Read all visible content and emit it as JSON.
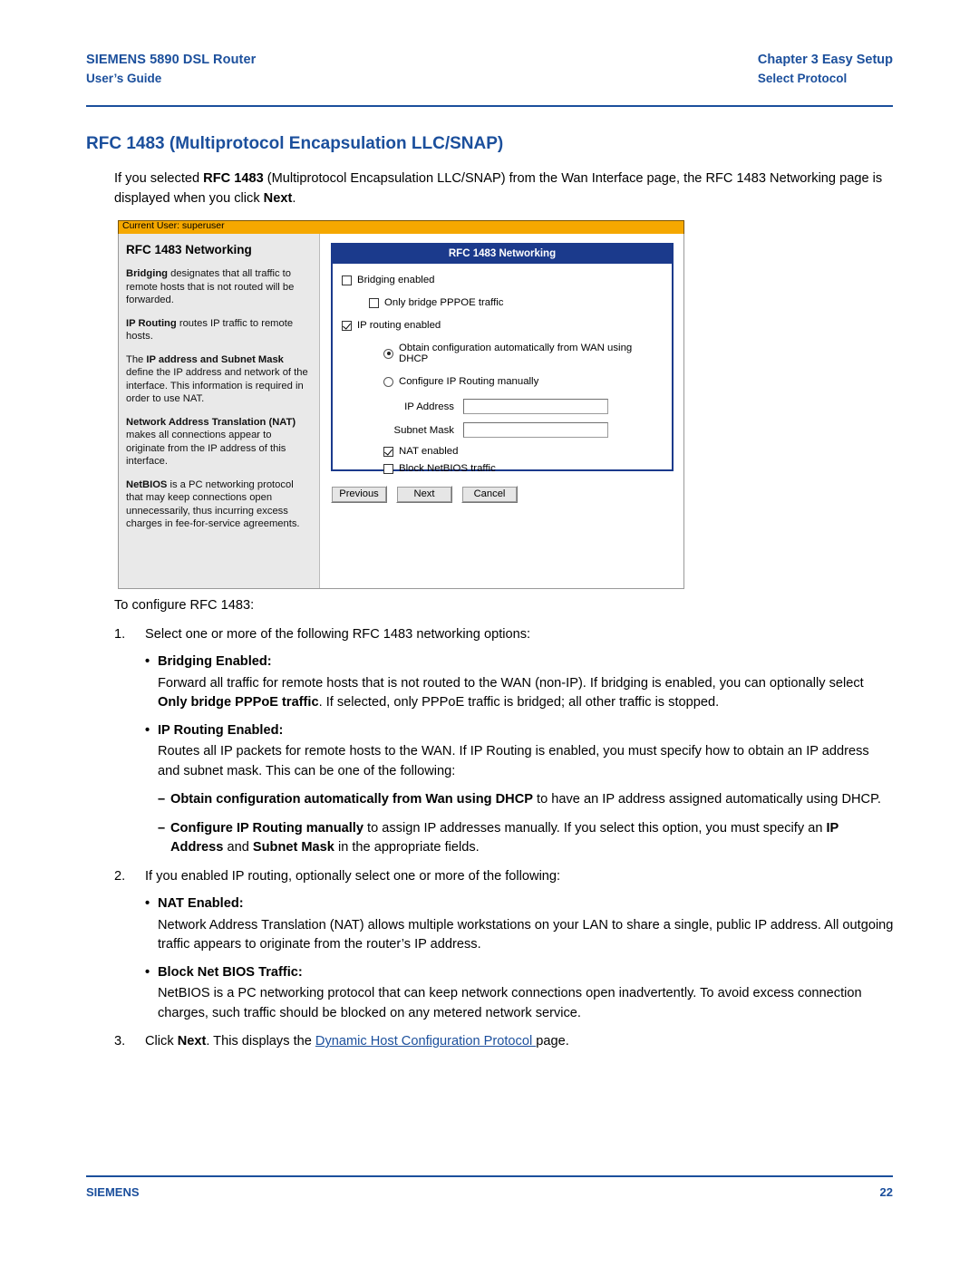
{
  "header": {
    "left_line1": "SIEMENS 5890 DSL Router",
    "left_line2": "User’s Guide",
    "right_line1": "Chapter 3  Easy Setup",
    "right_line2": "Select Protocol"
  },
  "title": "RFC 1483 (Multiprotocol Encapsulation LLC/SNAP)",
  "intro": {
    "part1": "If you selected ",
    "bold1": "RFC 1483",
    "part2": " (Multiprotocol Encapsulation LLC/SNAP",
    "part3": ") from the Wan Interface page, the RFC 1483 Networking page is displayed when you click ",
    "bold2": "Next",
    "part4": "."
  },
  "figure": {
    "current_user": "Current User: superuser",
    "left_panel": {
      "heading": "RFC 1483 Networking",
      "paragraphs": [
        {
          "bold": "Bridging",
          "rest": " designates that all traffic to remote hosts that is not routed will be forwarded."
        },
        {
          "bold": "IP Routing",
          "rest": " routes IP traffic to remote hosts."
        },
        {
          "pre": "The ",
          "bold": "IP address and Subnet Mask",
          "rest": " define the IP address and network of the interface. This information is required in order to use NAT."
        },
        {
          "bold": "Network Address Translation (NAT)",
          "rest": " makes all connections appear to originate from the IP address of this interface."
        },
        {
          "bold": "NetBIOS",
          "rest": " is a PC networking protocol that may keep connections open unnecessarily, thus incurring excess charges in fee-for-service agreements."
        }
      ]
    },
    "panel": {
      "title": "RFC 1483 Networking",
      "options": [
        {
          "type": "checkbox",
          "checked": false,
          "label": "Bridging enabled",
          "indent": 0
        },
        {
          "type": "checkbox",
          "checked": false,
          "label": "Only bridge PPPOE traffic",
          "indent": 1
        },
        {
          "type": "checkbox",
          "checked": true,
          "label": "IP routing enabled",
          "indent": 0
        },
        {
          "type": "radio",
          "checked": true,
          "label": "Obtain configuration automatically from WAN using DHCP",
          "indent": 2
        },
        {
          "type": "radio",
          "checked": false,
          "label": "Configure IP Routing manually",
          "indent": 2
        }
      ],
      "fields": [
        {
          "label": "IP Address",
          "value": ""
        },
        {
          "label": "Subnet Mask",
          "value": ""
        }
      ],
      "options2": [
        {
          "type": "checkbox",
          "checked": true,
          "label": "NAT enabled",
          "indent": 2
        },
        {
          "type": "checkbox",
          "checked": false,
          "label": "Block NetBIOS traffic",
          "indent": 2
        }
      ]
    },
    "buttons": [
      "Previous",
      "Next",
      "Cancel"
    ]
  },
  "body": {
    "to_configure": "To configure RFC 1483:",
    "item1_num": "1.",
    "item1_text": "Select one or more of the following RFC 1483 networking options:",
    "b1_label": "Bridging Enabled:",
    "b1_p1": "Forward all traffic for remote hosts that is not routed to the WAN (non-IP). If bridging is enabled, you can optionally select ",
    "b1_bold": "Only bridge PPPoE traffic",
    "b1_p2": ". If selected, only PPPoE traffic is bridged; all other traffic is stopped.",
    "b2_label": "IP Routing Enabled:",
    "b2_p1": "Routes all IP packets for remote hosts to the WAN. If IP Routing is enabled, you must specify how to obtain an IP address and subnet mask. This can be one of the following:",
    "d1_bold": "Obtain configuration automatically from Wan using DHCP",
    "d1_rest": " to have an IP address assigned automatically using DHCP.",
    "d2_bold": "Configure IP Routing manually",
    "d2_rest1": " to assign IP addresses manually. If you select this option, you must specify an ",
    "d2_bold2": "IP Address",
    "d2_rest2": " and ",
    "d2_bold3": "Subnet Mask",
    "d2_rest3": " in the appropriate fields.",
    "item2_num": "2.",
    "item2_text": "If you enabled IP routing, optionally select one or more of the following:",
    "b3_label": "NAT Enabled:",
    "b3_p1": "Network Address Translation (NAT) allows multiple workstations on your LAN to share a single, public IP address. All outgoing traffic appears to originate from the router’s IP address.",
    "b4_label": "Block Net BIOS Traffic:",
    "b4_p1": "NetBIOS is a PC networking protocol that can keep network connections open inadvertently. To avoid excess connection charges, such traffic should be blocked on any metered network service.",
    "item3_num": "3.",
    "item3_pre": "Click ",
    "item3_bold": "Next",
    "item3_mid": ". This displays the ",
    "item3_link": "Dynamic Host Configuration Protocol ",
    "item3_post": "page."
  },
  "footer": {
    "brand": "SIEMENS",
    "page": "22"
  }
}
